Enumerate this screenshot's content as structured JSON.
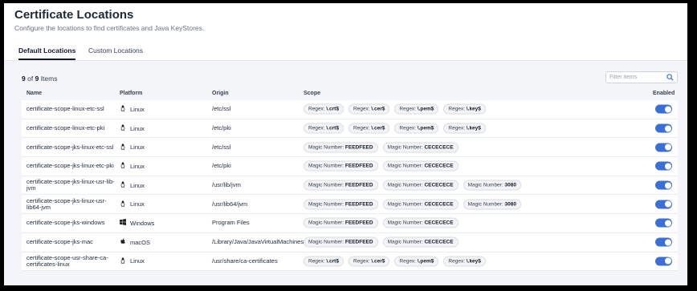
{
  "header": {
    "title": "Certificate Locations",
    "subtitle": "Configure the locations to find certificates and Java KeyStores."
  },
  "tabs": [
    {
      "label": "Default Locations",
      "active": true
    },
    {
      "label": "Custom Locations",
      "active": false
    }
  ],
  "table": {
    "count_shown": "9",
    "count_of": "of",
    "count_total": "9",
    "count_unit": "Items",
    "filter_placeholder": "Filter items",
    "columns": {
      "name": "Name",
      "platform": "Platform",
      "origin": "Origin",
      "scope": "Scope",
      "enabled": "Enabled"
    },
    "rows": [
      {
        "name": "certificate-scope-linux-etc-ssl",
        "platform": "Linux",
        "platform_icon": "linux-icon",
        "origin": "/etc/ssl",
        "scope": [
          {
            "k": "Regex:",
            "v": "\\.crt$"
          },
          {
            "k": "Regex:",
            "v": "\\.cer$"
          },
          {
            "k": "Regex:",
            "v": "\\.pem$"
          },
          {
            "k": "Regex:",
            "v": "\\.key$"
          }
        ],
        "enabled": true
      },
      {
        "name": "certificate-scope-linux-etc-pki",
        "platform": "Linux",
        "platform_icon": "linux-icon",
        "origin": "/etc/pki",
        "scope": [
          {
            "k": "Regex:",
            "v": "\\.crt$"
          },
          {
            "k": "Regex:",
            "v": "\\.cer$"
          },
          {
            "k": "Regex:",
            "v": "\\.pem$"
          },
          {
            "k": "Regex:",
            "v": "\\.key$"
          }
        ],
        "enabled": true
      },
      {
        "name": "certificate-scope-jks-linux-etc-ssl",
        "platform": "Linux",
        "platform_icon": "linux-icon",
        "origin": "/etc/ssl",
        "scope": [
          {
            "k": "Magic Number:",
            "v": "FEEDFEED"
          },
          {
            "k": "Magic Number:",
            "v": "CECECECE"
          }
        ],
        "enabled": true
      },
      {
        "name": "certificate-scope-jks-linux-etc-pki",
        "platform": "Linux",
        "platform_icon": "linux-icon",
        "origin": "/etc/pki",
        "scope": [
          {
            "k": "Magic Number:",
            "v": "FEEDFEED"
          },
          {
            "k": "Magic Number:",
            "v": "CECECECE"
          }
        ],
        "enabled": true
      },
      {
        "name": "certificate-scope-jks-linux-usr-lib-jvm",
        "platform": "Linux",
        "platform_icon": "linux-icon",
        "origin": "/usr/lib/jvm",
        "scope": [
          {
            "k": "Magic Number:",
            "v": "FEEDFEED"
          },
          {
            "k": "Magic Number:",
            "v": "CECECECE"
          },
          {
            "k": "Magic Number:",
            "v": "3080"
          }
        ],
        "enabled": true
      },
      {
        "name": "certificate-scope-jks-linux-usr-lib64-jvm",
        "platform": "Linux",
        "platform_icon": "linux-icon",
        "origin": "/usr/lib64/jvm",
        "scope": [
          {
            "k": "Magic Number:",
            "v": "FEEDFEED"
          },
          {
            "k": "Magic Number:",
            "v": "CECECECE"
          },
          {
            "k": "Magic Number:",
            "v": "3080"
          }
        ],
        "enabled": true
      },
      {
        "name": "certificate-scope-jks-windows",
        "platform": "Windows",
        "platform_icon": "windows-icon",
        "origin": "Program Files",
        "scope": [
          {
            "k": "Magic Number:",
            "v": "FEEDFEED"
          },
          {
            "k": "Magic Number:",
            "v": "CECECECE"
          }
        ],
        "enabled": true
      },
      {
        "name": "certificate-scope-jks-mac",
        "platform": "macOS",
        "platform_icon": "apple-icon",
        "origin": "/Library/Java/JavaVirtualMachines",
        "scope": [
          {
            "k": "Magic Number:",
            "v": "FEEDFEED"
          },
          {
            "k": "Magic Number:",
            "v": "CECECECE"
          }
        ],
        "enabled": true
      },
      {
        "name": "certificate-scope-usr-share-ca-certificates-linux",
        "platform": "Linux",
        "platform_icon": "linux-icon",
        "origin": "/usr/share/ca-certificates",
        "scope": [
          {
            "k": "Regex:",
            "v": "\\.crt$"
          },
          {
            "k": "Regex:",
            "v": "\\.cer$"
          },
          {
            "k": "Regex:",
            "v": "\\.pem$"
          },
          {
            "k": "Regex:",
            "v": "\\.key$"
          }
        ],
        "enabled": true
      }
    ]
  },
  "colors": {
    "accent": "#3b6fd6",
    "panel_bg": "#f3f5f9",
    "chip_bg": "#f3f4f6"
  }
}
